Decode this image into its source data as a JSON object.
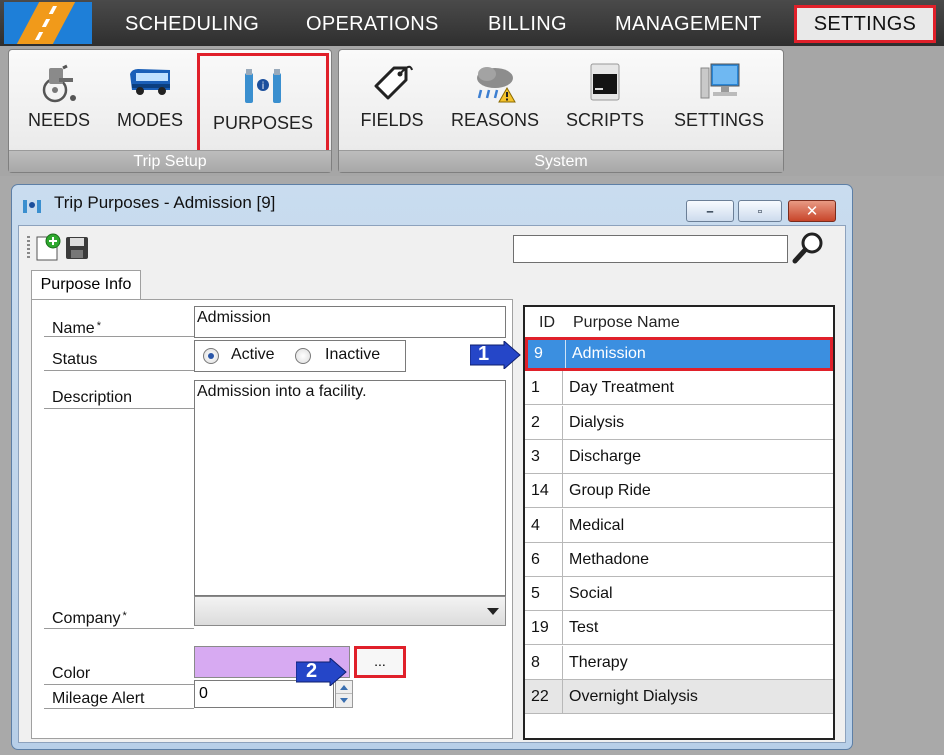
{
  "nav": {
    "items": [
      {
        "label": "SCHEDULING"
      },
      {
        "label": "OPERATIONS"
      },
      {
        "label": "BILLING"
      },
      {
        "label": "MANAGEMENT"
      },
      {
        "label": "SETTINGS",
        "active": true
      }
    ]
  },
  "ribbon": {
    "groups": [
      {
        "title": "Trip Setup",
        "buttons": [
          {
            "label": "NEEDS",
            "icon": "wheelchair-icon"
          },
          {
            "label": "MODES",
            "icon": "bus-icon"
          },
          {
            "label": "PURPOSES",
            "icon": "purposes-icon",
            "highlighted": true
          }
        ]
      },
      {
        "title": "System",
        "buttons": [
          {
            "label": "FIELDS",
            "icon": "tag-icon"
          },
          {
            "label": "REASONS",
            "icon": "storm-warning-icon"
          },
          {
            "label": "SCRIPTS",
            "icon": "terminal-icon"
          },
          {
            "label": "SETTINGS",
            "icon": "computer-icon"
          }
        ]
      }
    ]
  },
  "window": {
    "title": "Trip Purposes - Admission [9]",
    "controls": {
      "minimize": "–",
      "restore": "▫",
      "close": "✕"
    },
    "search": {
      "value": "",
      "placeholder": ""
    }
  },
  "form": {
    "tab_label": "Purpose Info",
    "name_label": "Name",
    "name_value": "Admission",
    "required_marker": "*",
    "status_label": "Status",
    "status_options": [
      "Active",
      "Inactive"
    ],
    "status_selected": "Active",
    "description_label": "Description",
    "description_value": "Admission into a facility.",
    "company_label": "Company",
    "company_value": "",
    "color_label": "Color",
    "color_value": "#d7aaf2",
    "color_button_label": "...",
    "mileage_label": "Mileage Alert",
    "mileage_value": "0"
  },
  "grid": {
    "headers": [
      "ID",
      "Purpose Name"
    ],
    "rows": [
      {
        "id": "9",
        "name": "Admission",
        "selected": true
      },
      {
        "id": "1",
        "name": "Day Treatment"
      },
      {
        "id": "2",
        "name": "Dialysis"
      },
      {
        "id": "3",
        "name": "Discharge"
      },
      {
        "id": "14",
        "name": "Group Ride"
      },
      {
        "id": "4",
        "name": "Medical"
      },
      {
        "id": "6",
        "name": "Methadone"
      },
      {
        "id": "5",
        "name": "Social"
      },
      {
        "id": "19",
        "name": "Test"
      },
      {
        "id": "8",
        "name": "Therapy"
      },
      {
        "id": "22",
        "name": "Overnight Dialysis"
      }
    ]
  },
  "callouts": [
    {
      "number": "1"
    },
    {
      "number": "2"
    }
  ],
  "colors": {
    "highlight_border": "#e0202a",
    "selection": "#3b8fe0",
    "callout": "#2546c8"
  }
}
